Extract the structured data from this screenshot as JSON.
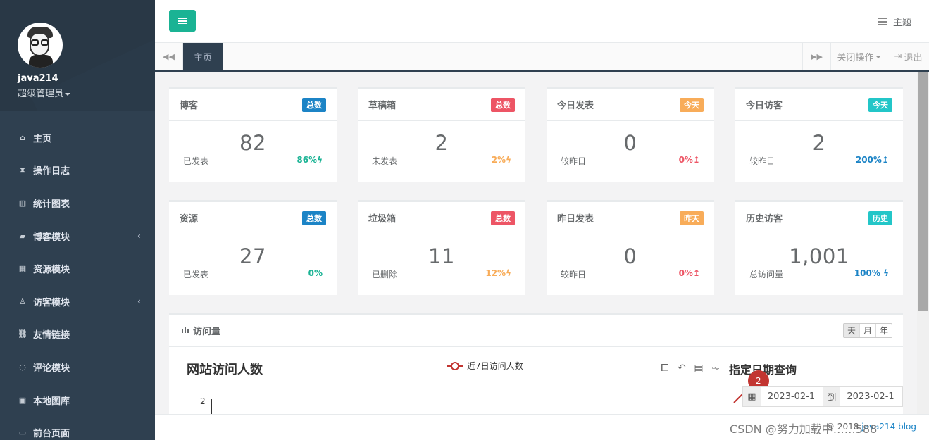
{
  "sidebar": {
    "username": "java214",
    "role": "超级管理员",
    "items": [
      {
        "label": "主页",
        "icon": "home-icon",
        "glyph": "⌂",
        "has_arrow": false
      },
      {
        "label": "操作日志",
        "icon": "hourglass-icon",
        "glyph": "⧗",
        "has_arrow": false
      },
      {
        "label": "统计图表",
        "icon": "bar-chart-icon",
        "glyph": "▥",
        "has_arrow": false
      },
      {
        "label": "博客模块",
        "icon": "book-icon",
        "glyph": "▰",
        "has_arrow": true
      },
      {
        "label": "资源模块",
        "icon": "table-icon",
        "glyph": "▦",
        "has_arrow": false
      },
      {
        "label": "访客模块",
        "icon": "person-icon",
        "glyph": "♙",
        "has_arrow": true
      },
      {
        "label": "友情链接",
        "icon": "link-icon",
        "glyph": "⛓",
        "has_arrow": false
      },
      {
        "label": "评论模块",
        "icon": "comment-icon",
        "glyph": "◌",
        "has_arrow": false
      },
      {
        "label": "本地图库",
        "icon": "image-icon",
        "glyph": "▣",
        "has_arrow": false
      },
      {
        "label": "前台页面",
        "icon": "desktop-icon",
        "glyph": "▭",
        "has_arrow": false
      }
    ],
    "arrow_glyph": "‹"
  },
  "header": {
    "theme_label": "主题"
  },
  "tabs": {
    "prev_glyph": "◀◀",
    "next_glyph": "▶▶",
    "active": "主页",
    "close_ops": "关闭操作",
    "logout": "退出",
    "logout_glyph": "⇥"
  },
  "cards": [
    {
      "title": "博客",
      "badge": "总数",
      "badge_color": "blue",
      "value": "82",
      "label": "已发表",
      "pct": "86%ϟ",
      "pct_color": "green"
    },
    {
      "title": "草稿箱",
      "badge": "总数",
      "badge_color": "red",
      "value": "2",
      "label": "未发表",
      "pct": "2%ϟ",
      "pct_color": "orange"
    },
    {
      "title": "今日发表",
      "badge": "今天",
      "badge_color": "orange",
      "value": "0",
      "label": "较昨日",
      "pct": "0%↥",
      "pct_color": "red"
    },
    {
      "title": "今日访客",
      "badge": "今天",
      "badge_color": "cyan",
      "value": "2",
      "label": "较昨日",
      "pct": "200%↥",
      "pct_color": "blue"
    },
    {
      "title": "资源",
      "badge": "总数",
      "badge_color": "blue",
      "value": "27",
      "label": "已发表",
      "pct": "0%",
      "pct_color": "green"
    },
    {
      "title": "垃圾箱",
      "badge": "总数",
      "badge_color": "red",
      "value": "11",
      "label": "已删除",
      "pct": "12%ϟ",
      "pct_color": "orange"
    },
    {
      "title": "昨日发表",
      "badge": "昨天",
      "badge_color": "orange",
      "value": "0",
      "label": "较昨日",
      "pct": "0%↥",
      "pct_color": "red"
    },
    {
      "title": "历史访客",
      "badge": "历史",
      "badge_color": "cyan",
      "value": "1,001",
      "label": "总访问量",
      "pct": "100% ϟ",
      "pct_color": "blue"
    }
  ],
  "panel": {
    "title": "访问量",
    "period_day": "天",
    "period_month": "月",
    "period_year": "年",
    "chart_title": "网站访问人数",
    "legend": "近7日访问人数",
    "toolbox": [
      "⧠",
      "↶",
      "▤",
      "⏦"
    ],
    "query_title": "指定日期查询",
    "marker_value": "2",
    "y_tick": "2",
    "date_from": "2023-02-1",
    "date_to_label": "到",
    "date_to": "2023-02-1",
    "calendar_glyph": "▦"
  },
  "chart_data": {
    "type": "line",
    "title": "网站访问人数",
    "series": [
      {
        "name": "近7日访问人数",
        "values": [
          2
        ]
      }
    ],
    "y_ticks": [
      "2"
    ],
    "markers": [
      {
        "label": "2"
      }
    ]
  },
  "footer": {
    "text": "© 2018 ",
    "link": "java214 blog",
    "watermark": "CSDN @努力加载中……588"
  },
  "colors": {
    "sidebar": "#2f4050",
    "accent": "#1ab394",
    "blue": "#1c84c6",
    "red": "#ed5565",
    "orange": "#f8ac59",
    "cyan": "#23c6c8",
    "chart_line": "#c23531"
  }
}
